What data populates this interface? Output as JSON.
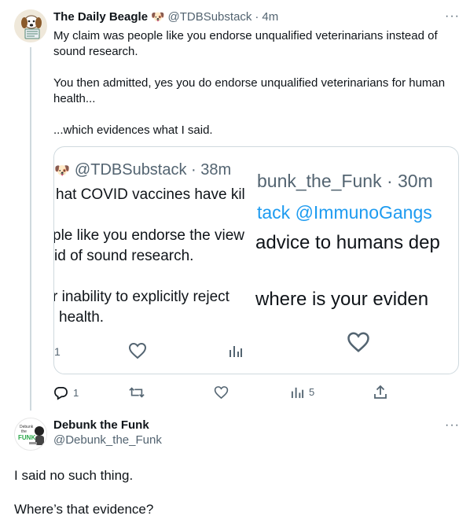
{
  "tweet1": {
    "display_name": "The Daily Beagle",
    "badge_emoji": "🐶",
    "handle": "@TDBSubstack",
    "time": "4m",
    "more": "···",
    "paragraphs": [
      "My claim was people like you endorse unqualified veterinarians instead of sound research.",
      "You then admitted, yes you do endorse unqualified veterinarians for human health...",
      "...which evidences what I said."
    ],
    "embed": {
      "left": {
        "header": "@TDBSubstack · 38m",
        "line1": "hat COVID vaccines have kil",
        "line2": "ple like you endorse the view",
        "line3": "id of sound research.",
        "line4": "r inability to explicitly reject",
        "line5": "health.",
        "reply_count": "1"
      },
      "right": {
        "header": "bunk_the_Funk · 30m",
        "line1": "tack @ImmunoGangs",
        "line2": "advice to humans dep",
        "line3": "where is your eviden"
      }
    },
    "actions": {
      "replies": "1",
      "retweets": "",
      "likes": "",
      "views": "5"
    }
  },
  "tweet2": {
    "display_name": "Debunk the Funk",
    "handle": "@Debunk_the_Funk",
    "more": "···",
    "avatar_text": "Debunk the FUNK",
    "paragraphs": [
      "I said no such thing.",
      "Where’s that evidence?"
    ]
  },
  "colors": {
    "text": "#0f1419",
    "muted": "#536471",
    "link": "#1d9bf0",
    "border": "#cfd9de"
  }
}
